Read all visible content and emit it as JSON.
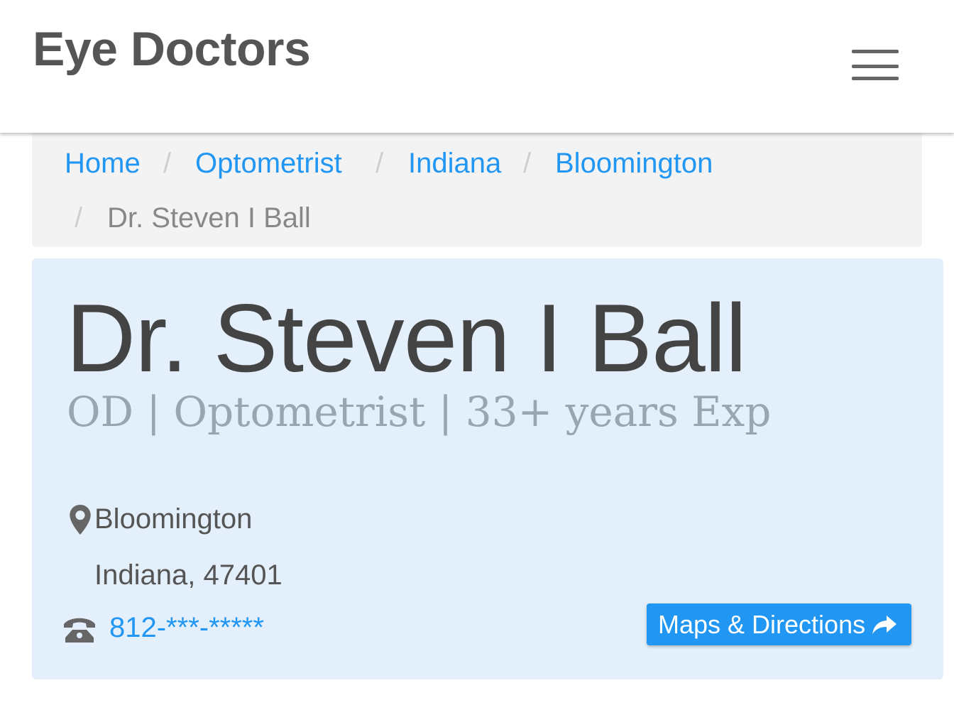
{
  "header": {
    "brand": "Eye Doctors",
    "menu_icon": "hamburger-menu-icon"
  },
  "breadcrumb": {
    "separator": "/",
    "items": [
      {
        "label": "Home",
        "link": true
      },
      {
        "label": "Optometrist",
        "link": true
      },
      {
        "label": "Indiana",
        "link": true
      },
      {
        "label": "Bloomington",
        "link": true
      },
      {
        "label": "Dr. Steven I Ball",
        "link": false
      }
    ]
  },
  "profile": {
    "name": "Dr. Steven I Ball",
    "subtitle": "OD | Optometrist | 33+ years Exp",
    "location_icon": "map-marker-icon",
    "city": "Bloomington",
    "state_zip": "Indiana, 47401",
    "phone_icon": "phone-icon",
    "phone": "812-***-*****",
    "maps_button_label": "Maps & Directions",
    "maps_button_icon": "share-arrow-icon"
  },
  "colors": {
    "link": "#2196f3",
    "card_background": "#e3f0fb",
    "breadcrumb_background": "#f3f3f3",
    "brand_text": "#555555",
    "subtitle_text": "#96a7b1",
    "button_background": "#2196f3"
  }
}
